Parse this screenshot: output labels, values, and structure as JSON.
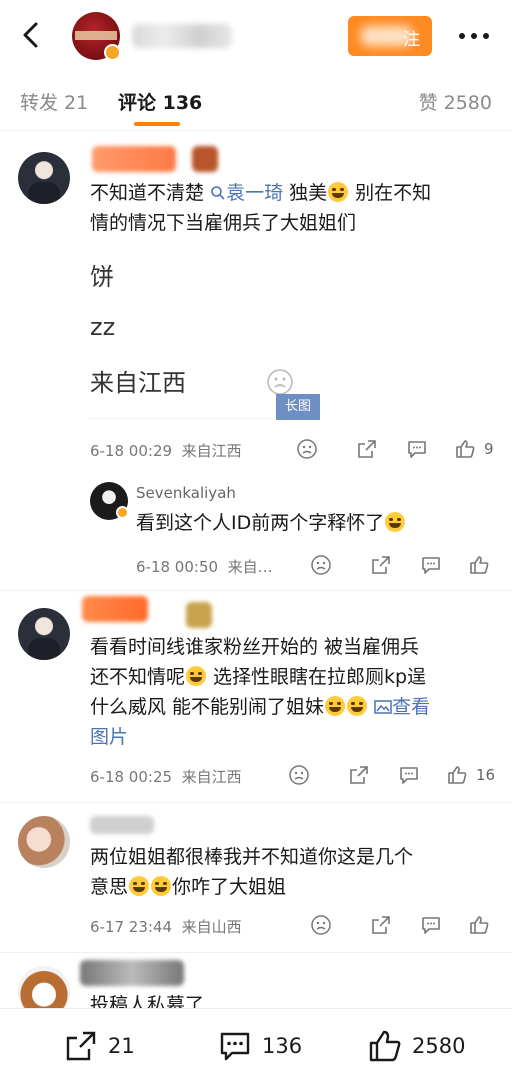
{
  "header": {
    "follow_suffix": "注"
  },
  "tabs": {
    "repost": "转发 21",
    "comments": "评论 136",
    "likes": "赞 2580"
  },
  "comments": [
    {
      "line1_pre": "不知道不清楚",
      "topic_link": "袁一琦",
      "line1_post": " 独美",
      "line1_tail": " 别在不知",
      "line2": "情的情况下当雇佣兵了大姐姐们",
      "img_line1": "饼",
      "img_line2": "zz",
      "img_line3": "来自江西",
      "long_image_tag": "长图",
      "time": "6-18 00:29",
      "location": "来自江西",
      "like_count": "9",
      "reply": {
        "username": "Sevenkaliyah",
        "text": "看到这个人ID前两个字释怀了",
        "time": "6-18 00:50",
        "location": "来自…"
      }
    },
    {
      "line1": "看看时间线谁家粉丝开始的 被当雇佣兵",
      "line2": "还不知情呢",
      "line2_post": " 选择性眼瞎在拉郎厕kp逞",
      "line3_pre": "什么威风 能不能别闹了姐妹",
      "view_image_link": "查看",
      "line4": "图片",
      "time": "6-18 00:25",
      "location": "来自江西",
      "like_count": "16"
    },
    {
      "line1": "两位姐姐都很棒我并不知道你这是几个",
      "line2_pre": "意思",
      "line2_post": "你咋了大姐姐",
      "time": "6-17 23:44",
      "location": "来自山西"
    },
    {
      "line1": "投稿人私募了"
    }
  ],
  "bottom_bar": {
    "repost_count": "21",
    "comment_count": "136",
    "like_count": "2580"
  },
  "colors": {
    "accent": "#ff8200",
    "link": "#4a74b6",
    "follow": "#fe8a22"
  }
}
